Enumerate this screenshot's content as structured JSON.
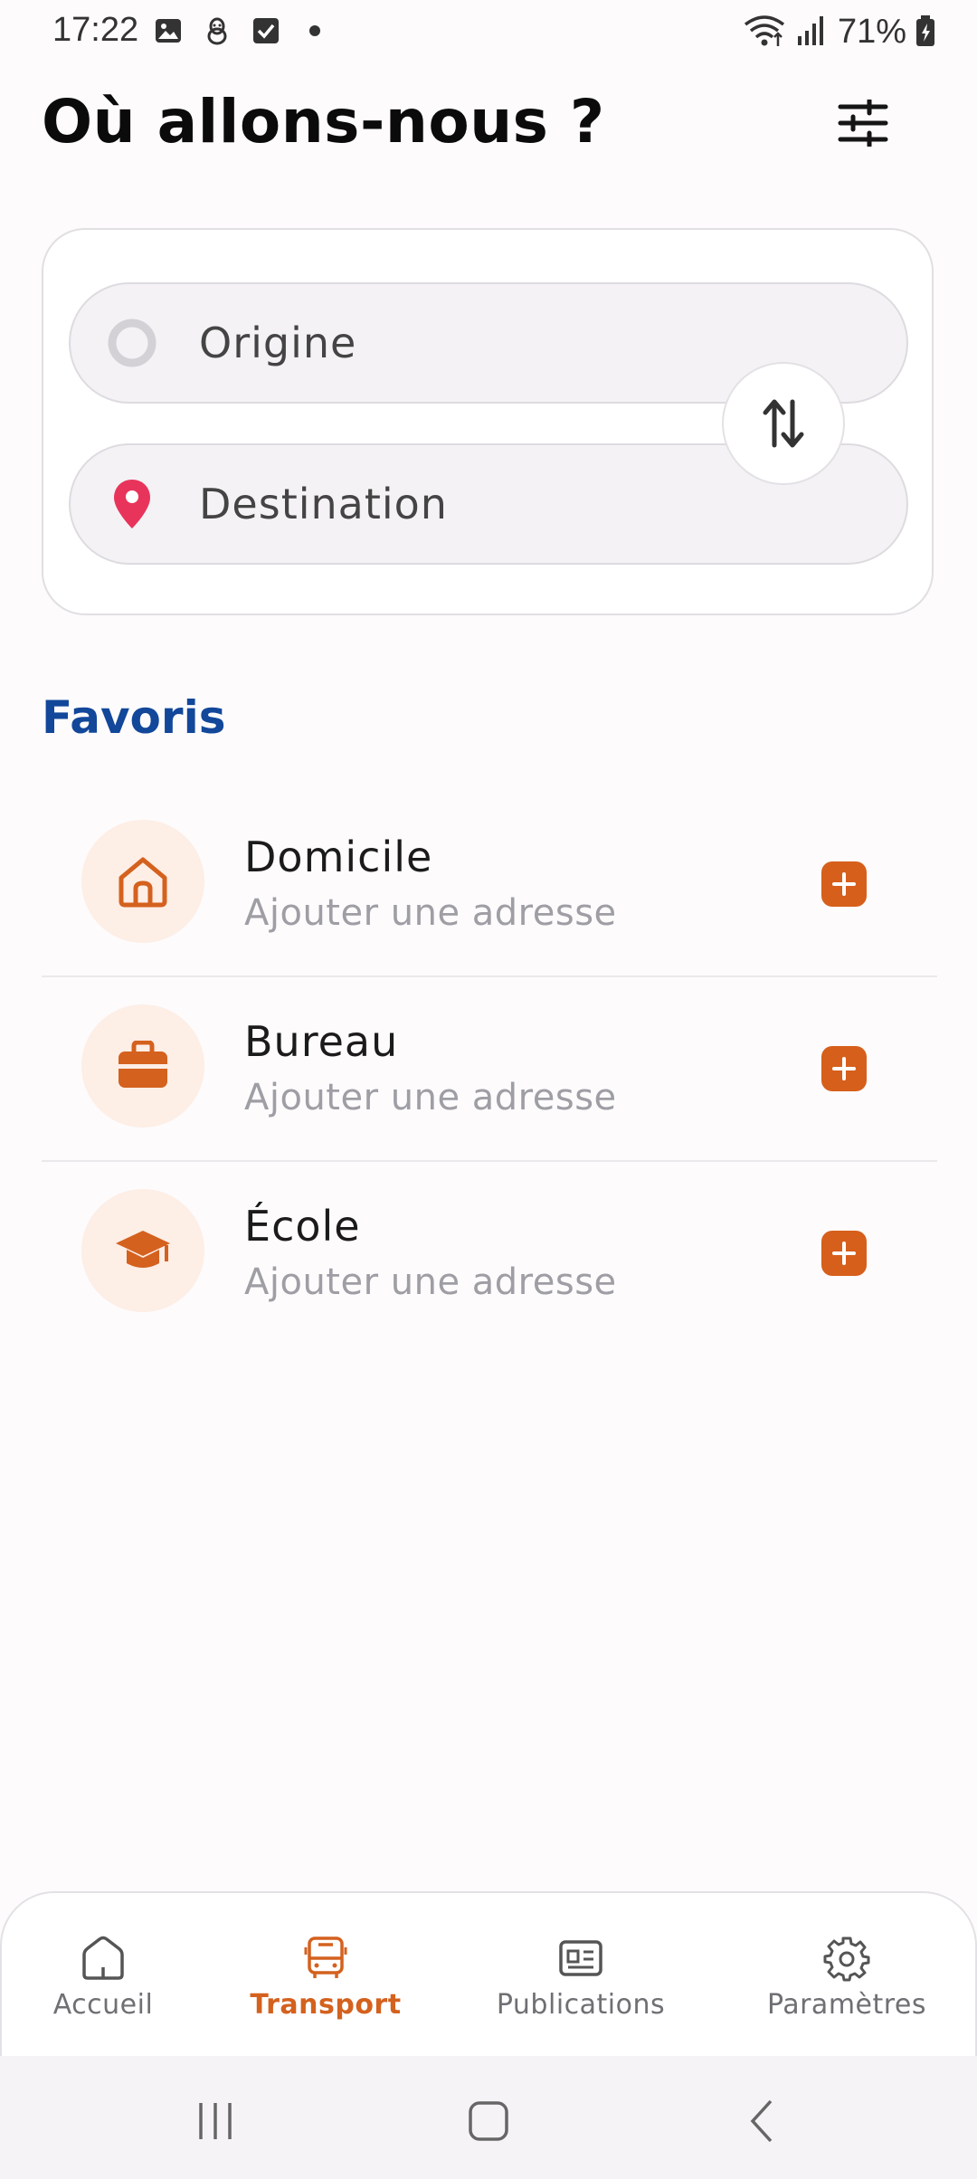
{
  "status_bar": {
    "time": "17:22",
    "battery": "71%",
    "left_icons": [
      "image-icon",
      "android-icon",
      "checkbox-icon",
      "dot-icon"
    ],
    "right_icons": [
      "wifi-icon",
      "signal-icon",
      "battery-icon"
    ]
  },
  "header": {
    "title": "Où allons-nous ?",
    "filter_icon": "sliders-icon"
  },
  "search": {
    "origin_placeholder": "Origine",
    "destination_placeholder": "Destination",
    "origin_icon": "origin-circle-icon",
    "destination_icon": "location-pin-icon",
    "swap_icon": "swap-vertical-icon"
  },
  "favorites": {
    "title": "Favoris",
    "items": [
      {
        "name": "Domicile",
        "subtitle": "Ajouter une adresse",
        "icon": "home-icon"
      },
      {
        "name": "Bureau",
        "subtitle": "Ajouter une adresse",
        "icon": "briefcase-icon"
      },
      {
        "name": "École",
        "subtitle": "Ajouter une adresse",
        "icon": "graduation-cap-icon"
      }
    ]
  },
  "bottom_nav": {
    "items": [
      {
        "label": "Accueil",
        "icon": "home-outline-icon",
        "active": false
      },
      {
        "label": "Transport",
        "icon": "bus-icon",
        "active": true
      },
      {
        "label": "Publications",
        "icon": "newspaper-icon",
        "active": false
      },
      {
        "label": "Paramètres",
        "icon": "gear-icon",
        "active": false
      }
    ]
  },
  "colors": {
    "accent": "#d4611e",
    "section_title": "#12479a",
    "pin": "#e8345b",
    "fav_icon_bg": "#fdeee6"
  }
}
